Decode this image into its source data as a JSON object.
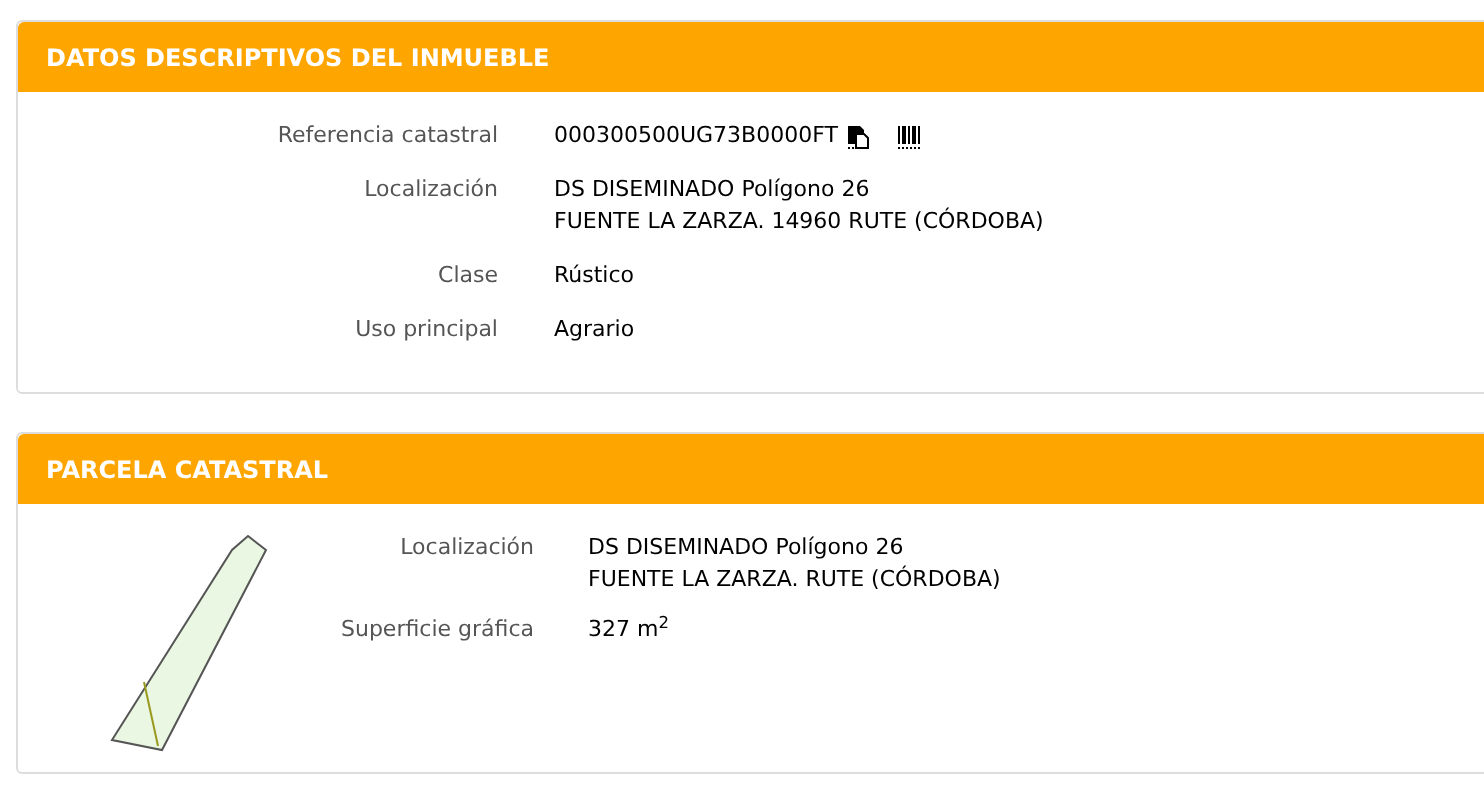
{
  "sections": [
    {
      "title": "DATOS DESCRIPTIVOS DEL INMUEBLE",
      "kind": "details",
      "fields": [
        {
          "label": "Referencia catastral",
          "lines": [
            "000300500UG73B0000FT"
          ],
          "actions": true
        },
        {
          "label": "Localización",
          "lines": [
            "DS DISEMINADO Polígono 26",
            "FUENTE LA ZARZA. 14960 RUTE (CÓRDOBA)"
          ]
        },
        {
          "label": "Clase",
          "lines": [
            "Rústico"
          ]
        },
        {
          "label": "Uso principal",
          "lines": [
            "Agrario"
          ]
        }
      ]
    },
    {
      "title": "PARCELA CATASTRAL",
      "kind": "parcel",
      "fields": [
        {
          "label": "Localización",
          "lines": [
            "DS DISEMINADO Polígono 26",
            "FUENTE LA ZARZA. RUTE (CÓRDOBA)"
          ]
        },
        {
          "label": "Superficie gráfica",
          "lines": [
            "327 m$^{2}$"
          ]
        }
      ]
    }
  ]
}
